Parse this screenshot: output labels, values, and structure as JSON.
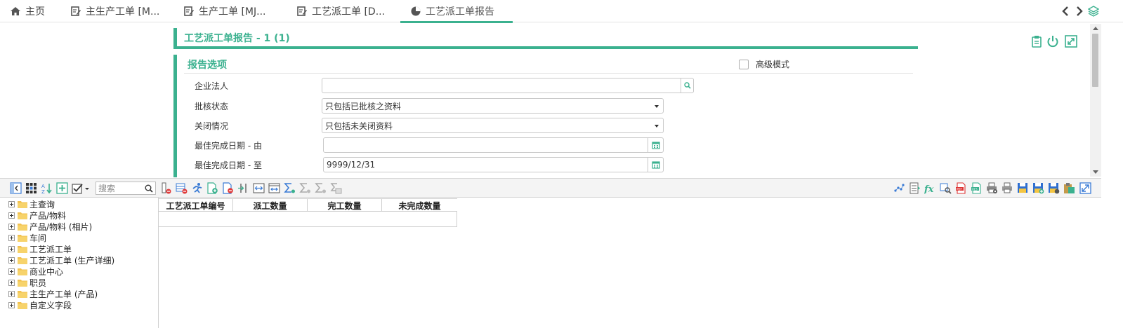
{
  "tabs": [
    {
      "label": "主页",
      "icon": "home-icon"
    },
    {
      "label": "主生产工单 [M...",
      "icon": "edit-doc-icon"
    },
    {
      "label": "生产工单 [MJ...",
      "icon": "edit-doc-icon"
    },
    {
      "label": "工艺派工单 [D...",
      "icon": "edit-doc-icon"
    },
    {
      "label": "工艺派工单报告",
      "icon": "pie-chart-icon",
      "active": true
    }
  ],
  "report": {
    "title": "工艺派工单报告 - 1 (1)",
    "options_header": "报告选项",
    "advanced_mode_label": "高级模式",
    "advanced_mode_checked": false
  },
  "form": {
    "legal_entity": {
      "label": "企业法人",
      "value": ""
    },
    "approval_status": {
      "label": "批核状态",
      "value": "只包括已批核之资料"
    },
    "close_status": {
      "label": "关闭情况",
      "value": "只包括未关闭资料"
    },
    "date_from": {
      "label": "最佳完成日期 - 由",
      "value": ""
    },
    "date_to": {
      "label": "最佳完成日期 - 至",
      "value": "9999/12/31"
    }
  },
  "toolbar": {
    "search_placeholder": "搜索"
  },
  "tree": {
    "items": [
      "主查询",
      "产品/物料",
      "产品/物料 (相片)",
      "车间",
      "工艺派工单",
      "工艺派工单 (生产详细)",
      "商业中心",
      "职员",
      "主生产工单 (产品)",
      "自定义字段"
    ]
  },
  "grid": {
    "columns": [
      "工艺派工单编号",
      "派工数量",
      "完工数量",
      "未完成数量"
    ]
  },
  "colors": {
    "accent": "#3bb18f"
  }
}
